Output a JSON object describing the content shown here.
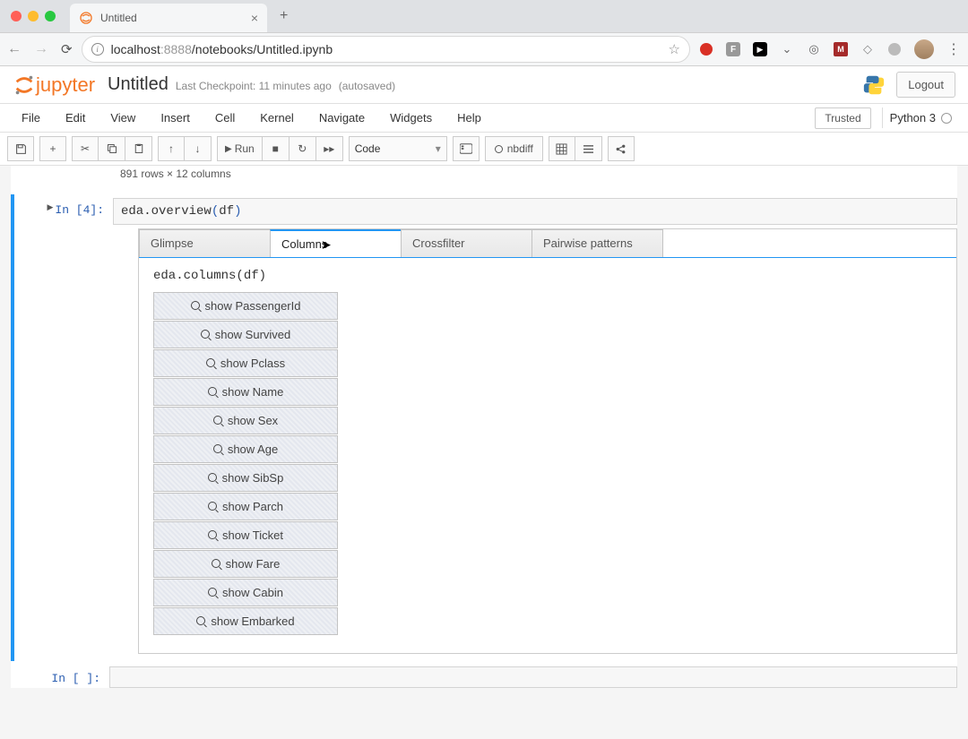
{
  "browser": {
    "tab_title": "Untitled",
    "url_host": "localhost",
    "url_port": ":8888",
    "url_path": "/notebooks/Untitled.ipynb"
  },
  "jupyter": {
    "logo_text": "jupyter",
    "notebook_name": "Untitled",
    "checkpoint": "Last Checkpoint: 11 minutes ago",
    "autosave": "(autosaved)",
    "logout_label": "Logout",
    "trusted_label": "Trusted",
    "kernel_label": "Python 3"
  },
  "menu": {
    "items": [
      "File",
      "Edit",
      "View",
      "Insert",
      "Cell",
      "Kernel",
      "Navigate",
      "Widgets",
      "Help"
    ]
  },
  "toolbar": {
    "run_label": "Run",
    "cell_type": "Code",
    "nbdiff_label": "nbdiff"
  },
  "notebook": {
    "rows_cols": "891 rows × 12 columns",
    "cell_in_prompt": "In [4]:",
    "cell_code": "eda.overview(df)",
    "cell_empty_prompt": "In [ ]:"
  },
  "widget": {
    "tabs": [
      "Glimpse",
      "Columns",
      "Crossfilter",
      "Pairwise patterns"
    ],
    "active_tab_index": 1,
    "inner_code": "eda.columns(df)",
    "show_prefix": "show ",
    "columns": [
      "PassengerId",
      "Survived",
      "Pclass",
      "Name",
      "Sex",
      "Age",
      "SibSp",
      "Parch",
      "Ticket",
      "Fare",
      "Cabin",
      "Embarked"
    ]
  }
}
